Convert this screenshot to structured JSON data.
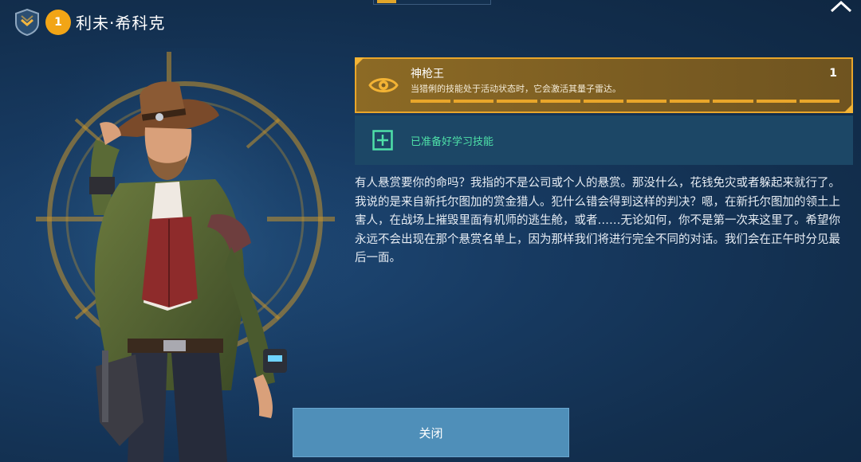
{
  "header": {
    "level": "1",
    "hero_name": "利未·希科克"
  },
  "skill": {
    "name": "神枪王",
    "description": "当猎俐的技能处于活动状态时，它会激活其量子雷达。",
    "level": "1",
    "progress_segments": 10,
    "icon": "eye-icon"
  },
  "learn": {
    "label": "已准备好学习技能",
    "icon": "plus-icon"
  },
  "story": "有人悬赏要你的命吗？我指的不是公司或个人的悬赏。那没什么，花钱免灾或者躲起来就行了。我说的是来自新托尔图加的赏金猎人。犯什么错会得到这样的判决？嗯，在新托尔图加的领土上害人，在战场上摧毁里面有机师的逃生舱，或者……无论如何，你不是第一次来这里了。希望你永远不会出现在那个悬赏名单上，因为那样我们将进行完全不同的对话。我们会在正午时分见最后一面。",
  "buttons": {
    "close": "关闭"
  },
  "colors": {
    "accent_gold": "#e9a62a",
    "learn_green": "#4ee0a8",
    "button_blue": "#4f8fb9"
  }
}
